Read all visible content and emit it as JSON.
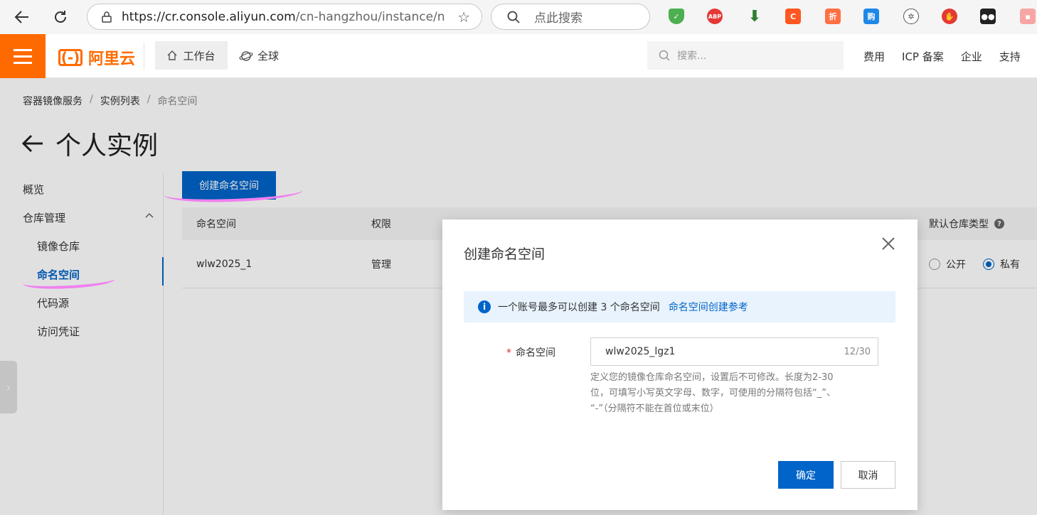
{
  "browser": {
    "url_host": "https://cr.console.aliyun.com",
    "url_path": "/cn-hangzhou/instance/n...",
    "search_placeholder": "点此搜索",
    "ext_labels": [
      "ABP",
      "C",
      "折",
      "购"
    ]
  },
  "console": {
    "logo_text": "阿里云",
    "logo_mark": "(-)",
    "workbench": "工作台",
    "region": "全球",
    "search_placeholder": "搜索...",
    "links": [
      "费用",
      "ICP 备案",
      "企业",
      "支持"
    ]
  },
  "breadcrumb": [
    "容器镜像服务",
    "实例列表",
    "命名空间"
  ],
  "page": {
    "title": "个人实例"
  },
  "sidebar": {
    "items": [
      {
        "label": "概览"
      },
      {
        "label": "仓库管理"
      },
      {
        "label": "镜像仓库"
      },
      {
        "label": "命名空间"
      },
      {
        "label": "代码源"
      },
      {
        "label": "访问凭证"
      }
    ]
  },
  "main": {
    "create_button": "创建命名空间",
    "table": {
      "headers": {
        "namespace": "命名空间",
        "permission": "权限",
        "default_type": "默认仓库类型"
      },
      "rows": [
        {
          "namespace": "wlw2025_1",
          "permission": "管理",
          "public_label": "公开",
          "private_label": "私有"
        }
      ]
    }
  },
  "dialog": {
    "title": "创建命名空间",
    "notice_text": "一个账号最多可以创建 3 个命名空间",
    "notice_link": "命名空间创建参考",
    "field_label": "命名空间",
    "field_value": "wlw2025_lgz1",
    "field_count": "12/30",
    "help_line1": "定义您的镜像仓库命名空间，设置后不可修改。长度为2-30",
    "help_line2": "位，可填写小写英文字母、数字，可使用的分隔符包括“_”、",
    "help_line3": "“-”（分隔符不能在首位或末位）",
    "ok_label": "确定",
    "cancel_label": "取消"
  },
  "colors": {
    "primary": "#0064c8",
    "brand": "#ff6a00",
    "highlight": "#f080f0"
  }
}
